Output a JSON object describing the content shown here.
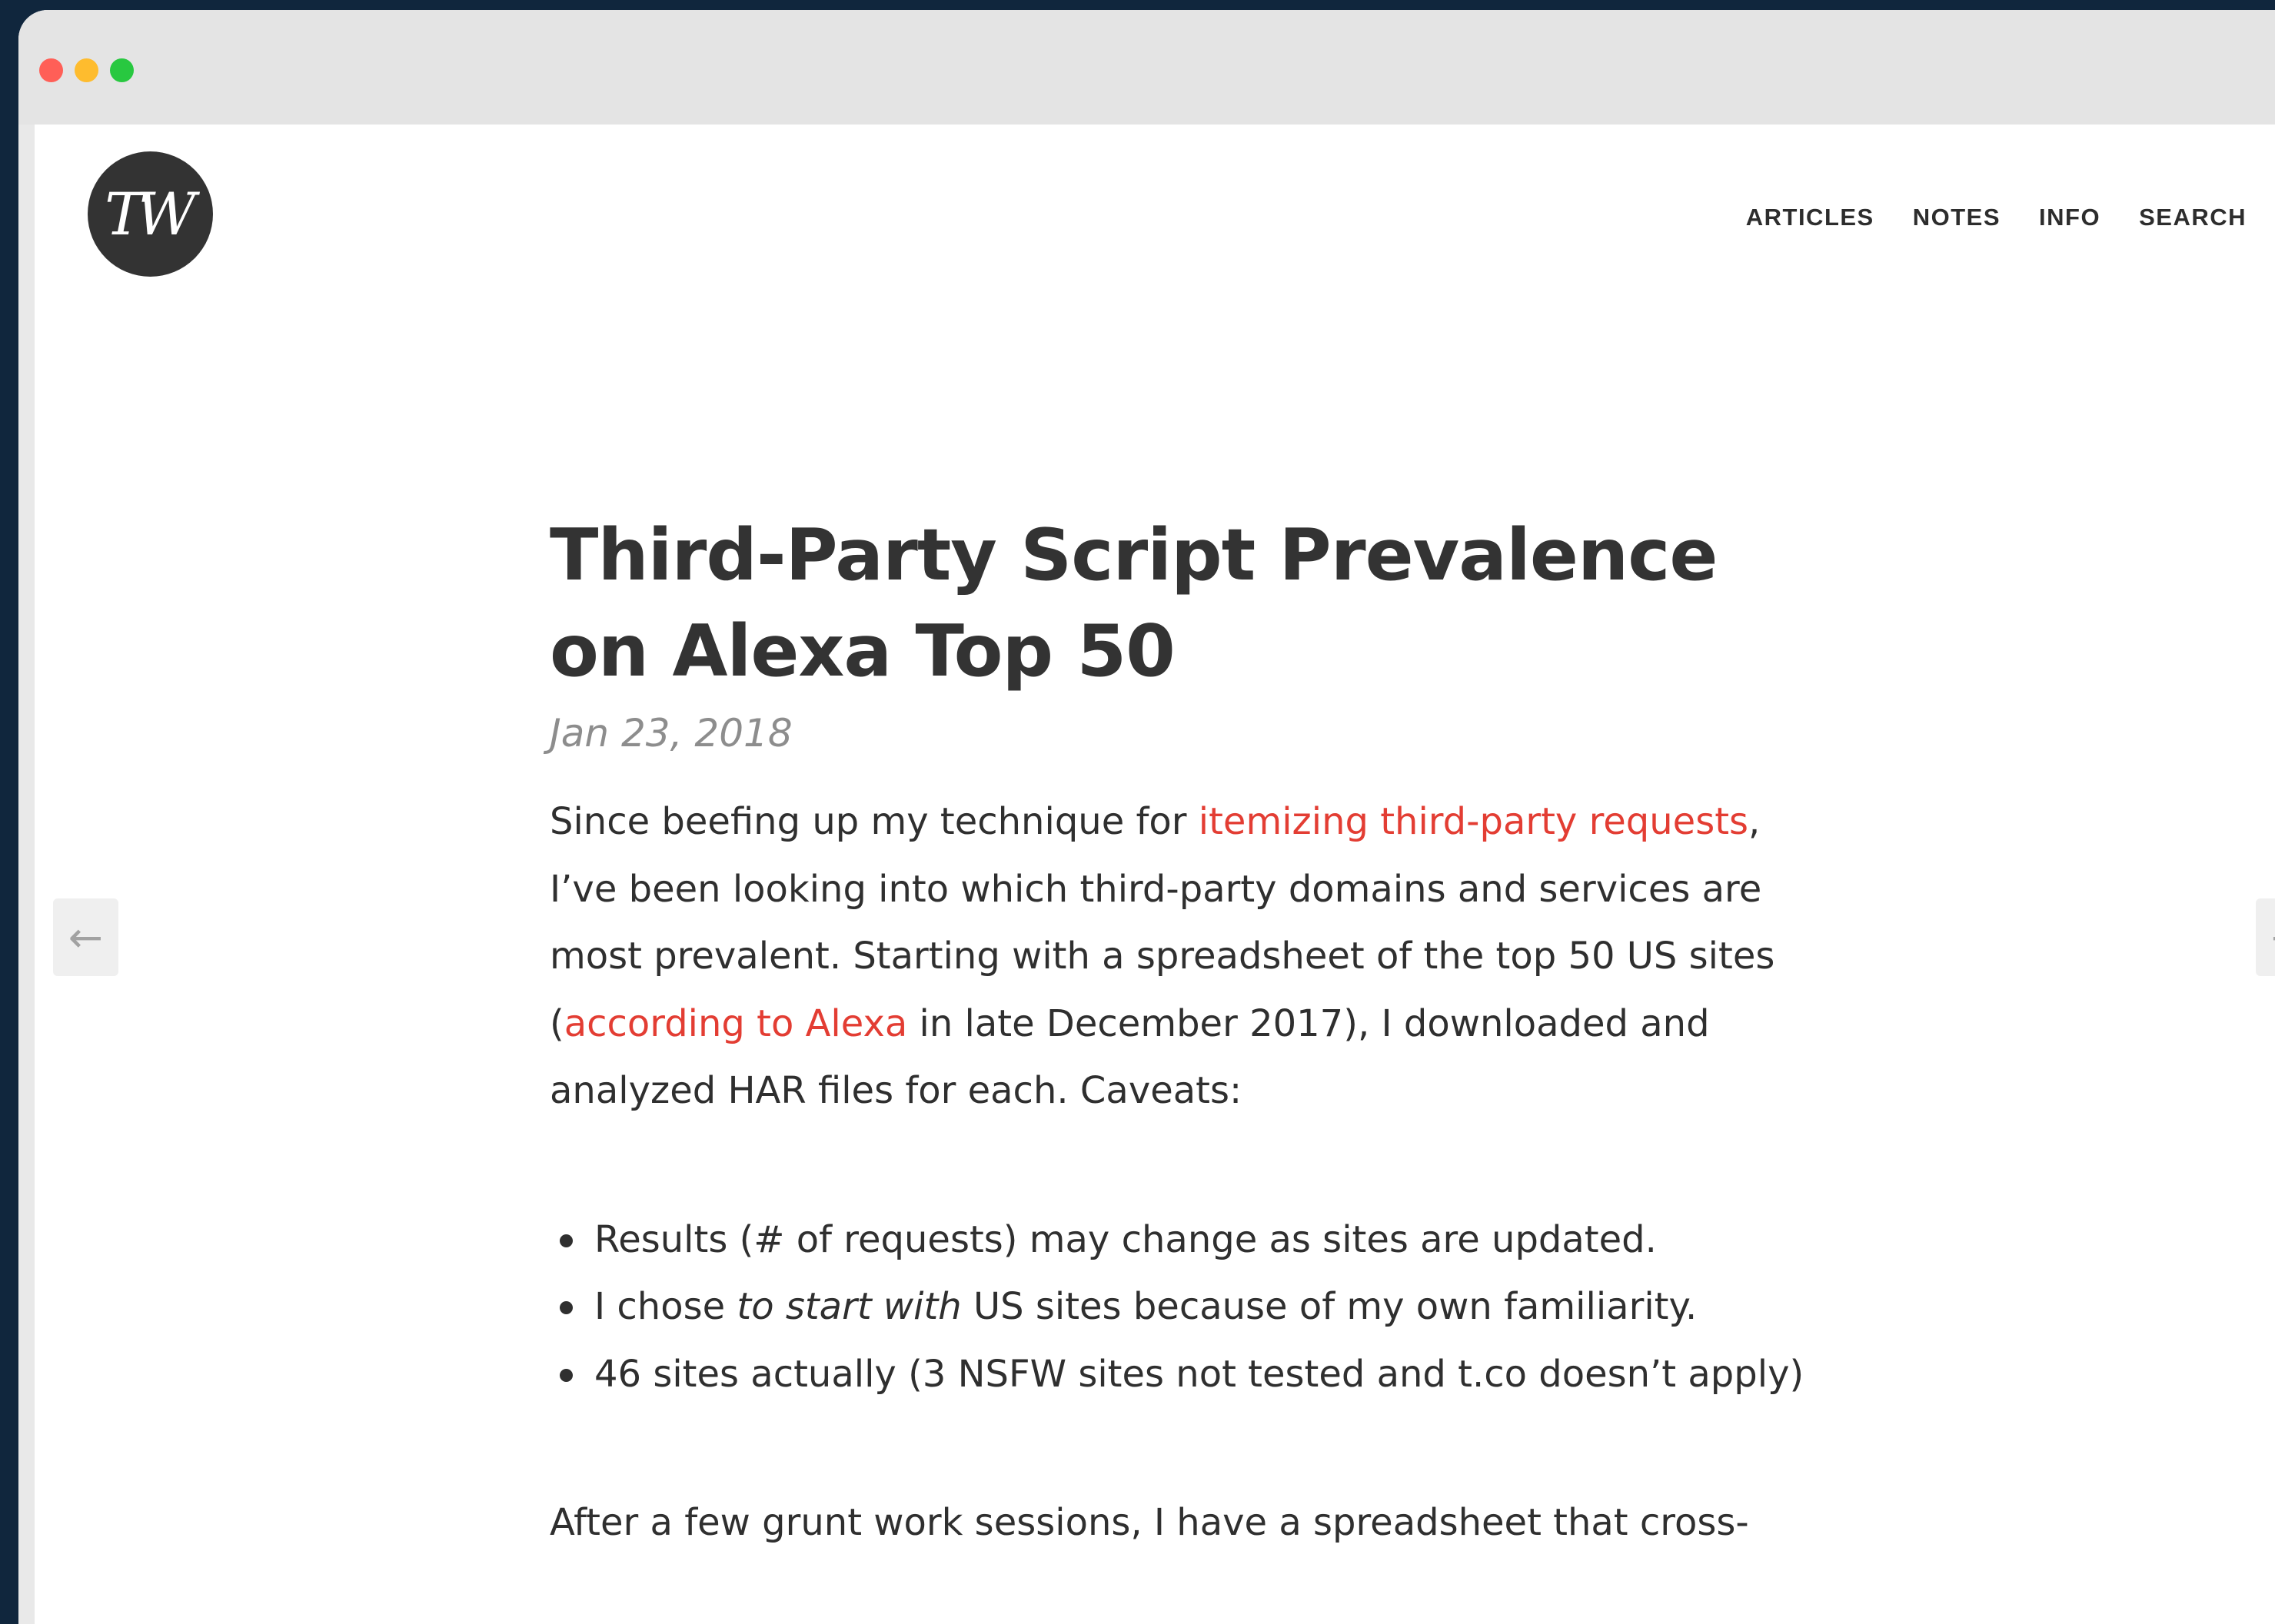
{
  "window": {
    "controls": {
      "close_color": "#ff5f57",
      "minimize_color": "#febc2e",
      "maximize_color": "#28c840"
    }
  },
  "header": {
    "logo_text": "TW",
    "nav": [
      "ARTICLES",
      "NOTES",
      "INFO",
      "SEARCH"
    ]
  },
  "navigation": {
    "prev_arrow": "←",
    "next_arrow": "→"
  },
  "article": {
    "title": "Third-Party Script Prevalence on Alexa Top 50",
    "date": "Jan 23, 2018",
    "intro": {
      "t1": "Since beefing up my technique for ",
      "link1": "itemizing third-party requests",
      "t2": ", I’ve been looking into which third-party domains and services are most prevalent. Starting with a spreadsheet of the top 50 US sites (",
      "link2": "according to Alexa",
      "t3": " in late December 2017), I downloaded and analyzed HAR files for each. Caveats:"
    },
    "bullets": {
      "b1": "Results (# of requests) may change as sites are updated.",
      "b2_before": "I chose ",
      "b2_em": "to start with",
      "b2_after": " US sites because of my own familiarity.",
      "b3": "46 sites actually (3 NSFW sites not tested and t.co doesn’t apply)"
    },
    "closing": "After a few grunt work sessions, I have a spreadsheet that cross-"
  },
  "colors": {
    "link": "#e33d33",
    "text": "#2f2f2f",
    "date": "#8d8d8d",
    "background": "#10263d"
  }
}
